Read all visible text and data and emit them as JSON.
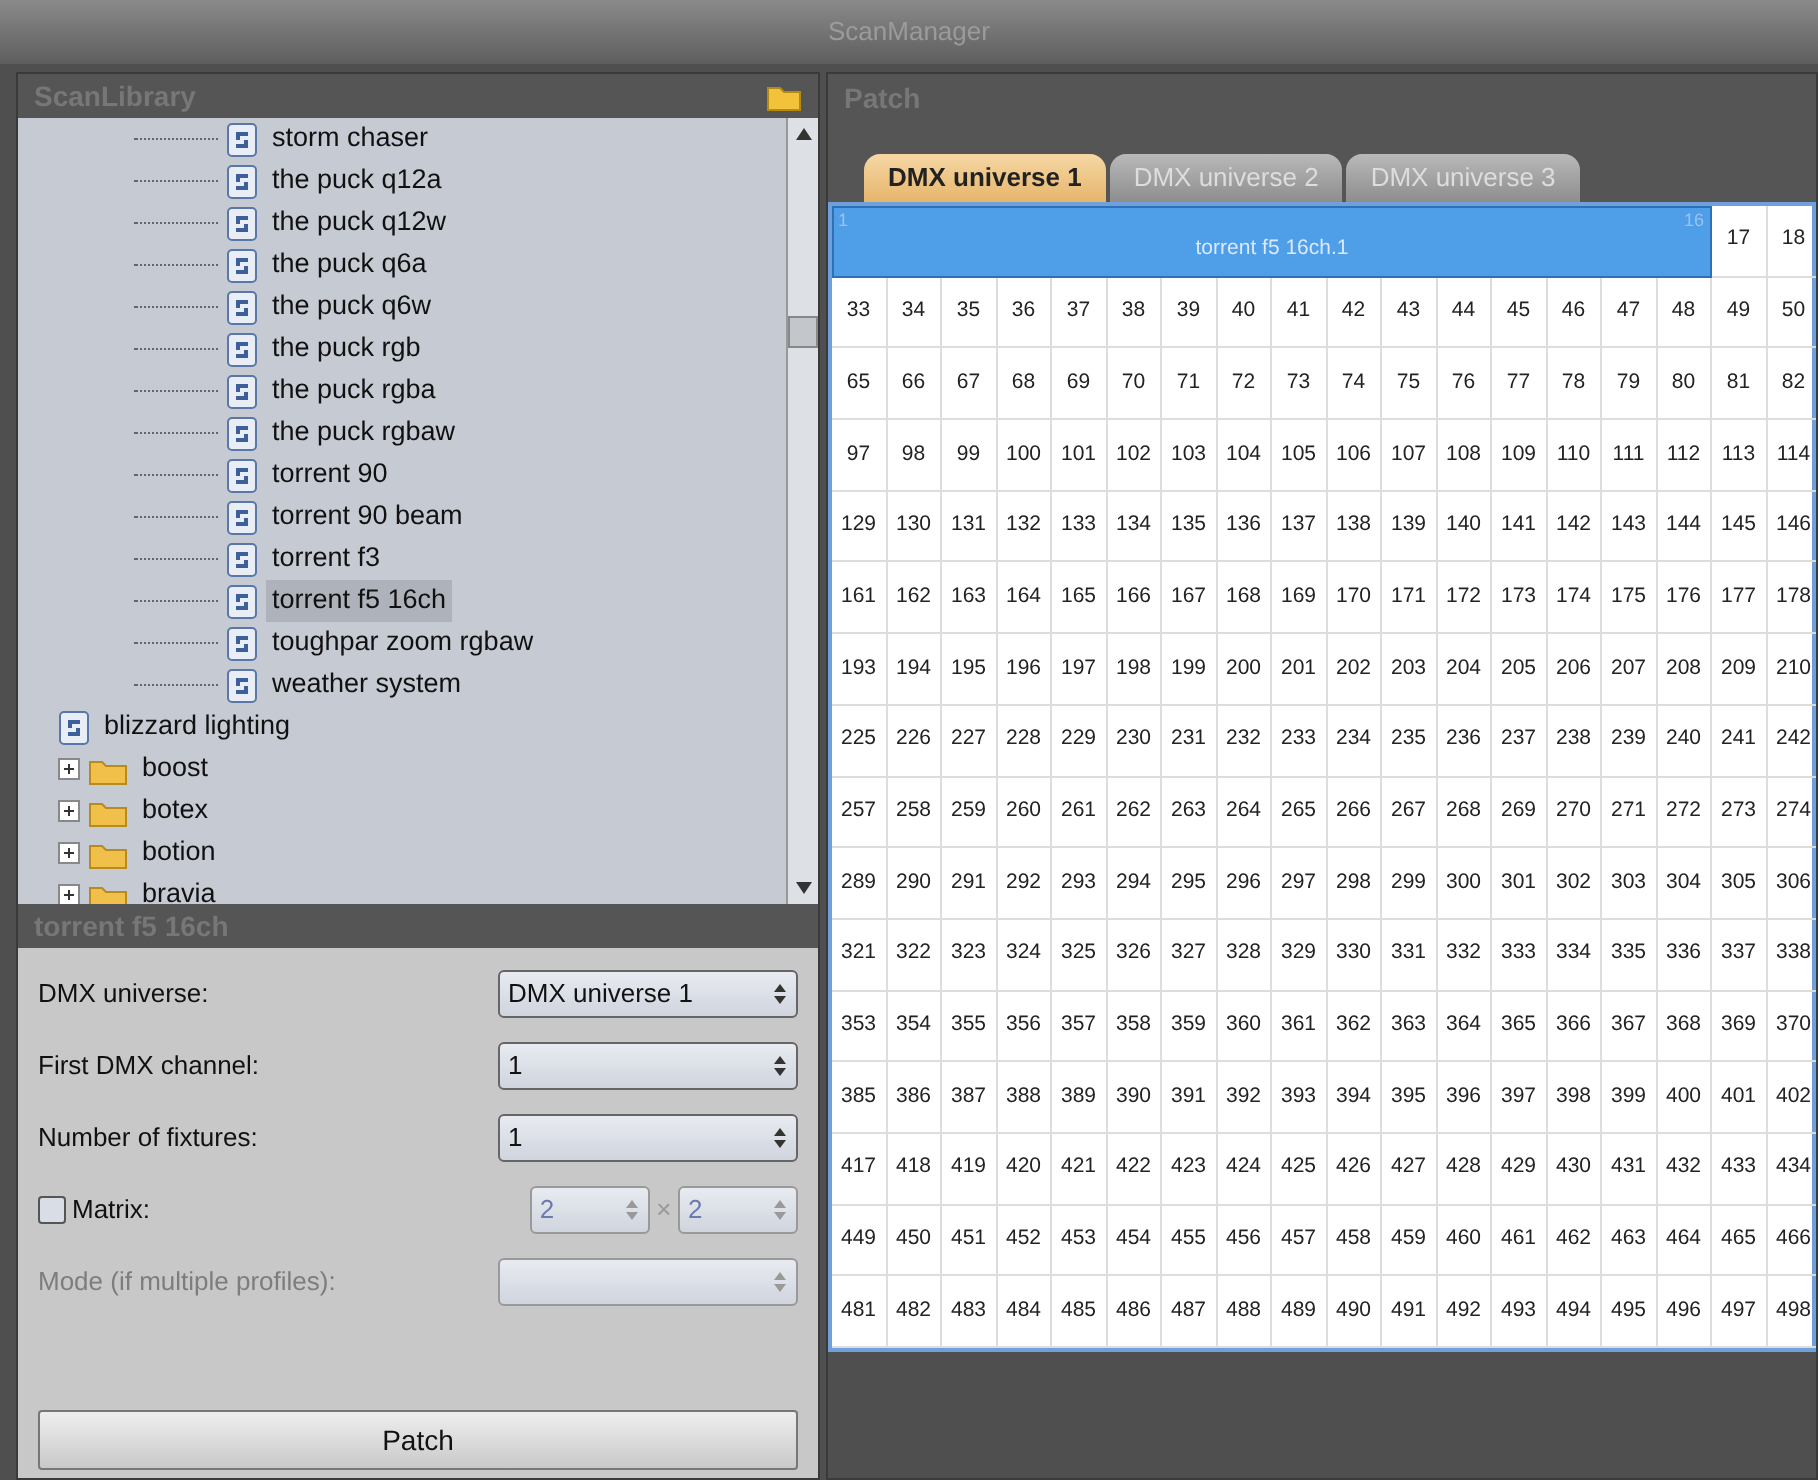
{
  "window": {
    "title": "ScanManager"
  },
  "library": {
    "title": "ScanLibrary",
    "tree": [
      {
        "kind": "group",
        "children": [
          {
            "kind": "fixture",
            "label": "storm chaser",
            "selected": false
          },
          {
            "kind": "fixture",
            "label": "the puck q12a",
            "selected": false
          },
          {
            "kind": "fixture",
            "label": "the puck q12w",
            "selected": false
          },
          {
            "kind": "fixture",
            "label": "the puck q6a",
            "selected": false
          },
          {
            "kind": "fixture",
            "label": "the puck q6w",
            "selected": false
          },
          {
            "kind": "fixture",
            "label": "the puck rgb",
            "selected": false
          },
          {
            "kind": "fixture",
            "label": "the puck rgba",
            "selected": false
          },
          {
            "kind": "fixture",
            "label": "the puck rgbaw",
            "selected": false
          },
          {
            "kind": "fixture",
            "label": "torrent 90",
            "selected": false
          },
          {
            "kind": "fixture",
            "label": "torrent 90 beam",
            "selected": false
          },
          {
            "kind": "fixture",
            "label": "torrent f3",
            "selected": false
          },
          {
            "kind": "fixture",
            "label": "torrent f5 16ch",
            "selected": true
          },
          {
            "kind": "fixture",
            "label": "toughpar zoom rgbaw",
            "selected": false
          },
          {
            "kind": "fixture",
            "label": "weather system",
            "selected": false
          }
        ]
      },
      {
        "kind": "fixture",
        "label": "blizzard lighting",
        "selected": false
      },
      {
        "kind": "folder",
        "label": "boost",
        "expanded": false
      },
      {
        "kind": "folder",
        "label": "botex",
        "expanded": false
      },
      {
        "kind": "folder",
        "label": "botion",
        "expanded": false
      },
      {
        "kind": "folder",
        "label": "bravia",
        "expanded": false
      }
    ]
  },
  "properties": {
    "title": "torrent f5 16ch",
    "fields": [
      {
        "kind": "select",
        "label": "DMX universe:",
        "value": "DMX universe 1",
        "disabled": false
      },
      {
        "kind": "spin",
        "label": "First DMX channel:",
        "value": "1",
        "disabled": false
      },
      {
        "kind": "spin",
        "label": "Number of fixtures:",
        "value": "1",
        "disabled": false
      },
      {
        "kind": "matrix",
        "label": "Matrix:",
        "checked": false,
        "value": "2",
        "separator": "×",
        "value_2": "2",
        "disabled": true
      },
      {
        "kind": "select",
        "label": "Mode (if multiple profiles):",
        "disabled": true
      }
    ],
    "button": "Patch"
  },
  "patch": {
    "title": "Patch",
    "tabs": [
      {
        "label": "DMX universe 1",
        "selected": true
      },
      {
        "label": "DMX universe 2",
        "selected": false
      },
      {
        "label": "DMX universe 3",
        "selected": false
      }
    ],
    "patched": {
      "label": "torrent f5 16ch.1",
      "start": "1",
      "end": "16"
    },
    "rows": [
      [
        "",
        "",
        "",
        "",
        "",
        "",
        "",
        "",
        "",
        "",
        "",
        "",
        "",
        "",
        "",
        "",
        "17",
        "18"
      ],
      [
        "33",
        "34",
        "35",
        "36",
        "37",
        "38",
        "39",
        "40",
        "41",
        "42",
        "43",
        "44",
        "45",
        "46",
        "47",
        "48",
        "49",
        "50"
      ],
      [
        "65",
        "66",
        "67",
        "68",
        "69",
        "70",
        "71",
        "72",
        "73",
        "74",
        "75",
        "76",
        "77",
        "78",
        "79",
        "80",
        "81",
        "82"
      ],
      [
        "97",
        "98",
        "99",
        "100",
        "101",
        "102",
        "103",
        "104",
        "105",
        "106",
        "107",
        "108",
        "109",
        "110",
        "111",
        "112",
        "113",
        "114"
      ],
      [
        "129",
        "130",
        "131",
        "132",
        "133",
        "134",
        "135",
        "136",
        "137",
        "138",
        "139",
        "140",
        "141",
        "142",
        "143",
        "144",
        "145",
        "146"
      ],
      [
        "161",
        "162",
        "163",
        "164",
        "165",
        "166",
        "167",
        "168",
        "169",
        "170",
        "171",
        "172",
        "173",
        "174",
        "175",
        "176",
        "177",
        "178"
      ],
      [
        "193",
        "194",
        "195",
        "196",
        "197",
        "198",
        "199",
        "200",
        "201",
        "202",
        "203",
        "204",
        "205",
        "206",
        "207",
        "208",
        "209",
        "210"
      ],
      [
        "225",
        "226",
        "227",
        "228",
        "229",
        "230",
        "231",
        "232",
        "233",
        "234",
        "235",
        "236",
        "237",
        "238",
        "239",
        "240",
        "241",
        "242"
      ],
      [
        "257",
        "258",
        "259",
        "260",
        "261",
        "262",
        "263",
        "264",
        "265",
        "266",
        "267",
        "268",
        "269",
        "270",
        "271",
        "272",
        "273",
        "274"
      ],
      [
        "289",
        "290",
        "291",
        "292",
        "293",
        "294",
        "295",
        "296",
        "297",
        "298",
        "299",
        "300",
        "301",
        "302",
        "303",
        "304",
        "305",
        "306"
      ],
      [
        "321",
        "322",
        "323",
        "324",
        "325",
        "326",
        "327",
        "328",
        "329",
        "330",
        "331",
        "332",
        "333",
        "334",
        "335",
        "336",
        "337",
        "338"
      ],
      [
        "353",
        "354",
        "355",
        "356",
        "357",
        "358",
        "359",
        "360",
        "361",
        "362",
        "363",
        "364",
        "365",
        "366",
        "367",
        "368",
        "369",
        "370"
      ],
      [
        "385",
        "386",
        "387",
        "388",
        "389",
        "390",
        "391",
        "392",
        "393",
        "394",
        "395",
        "396",
        "397",
        "398",
        "399",
        "400",
        "401",
        "402"
      ],
      [
        "417",
        "418",
        "419",
        "420",
        "421",
        "422",
        "423",
        "424",
        "425",
        "426",
        "427",
        "428",
        "429",
        "430",
        "431",
        "432",
        "433",
        "434"
      ],
      [
        "449",
        "450",
        "451",
        "452",
        "453",
        "454",
        "455",
        "456",
        "457",
        "458",
        "459",
        "460",
        "461",
        "462",
        "463",
        "464",
        "465",
        "466"
      ],
      [
        "481",
        "482",
        "483",
        "484",
        "485",
        "486",
        "487",
        "488",
        "489",
        "490",
        "491",
        "492",
        "493",
        "494",
        "495",
        "496",
        "497",
        "498"
      ]
    ]
  }
}
